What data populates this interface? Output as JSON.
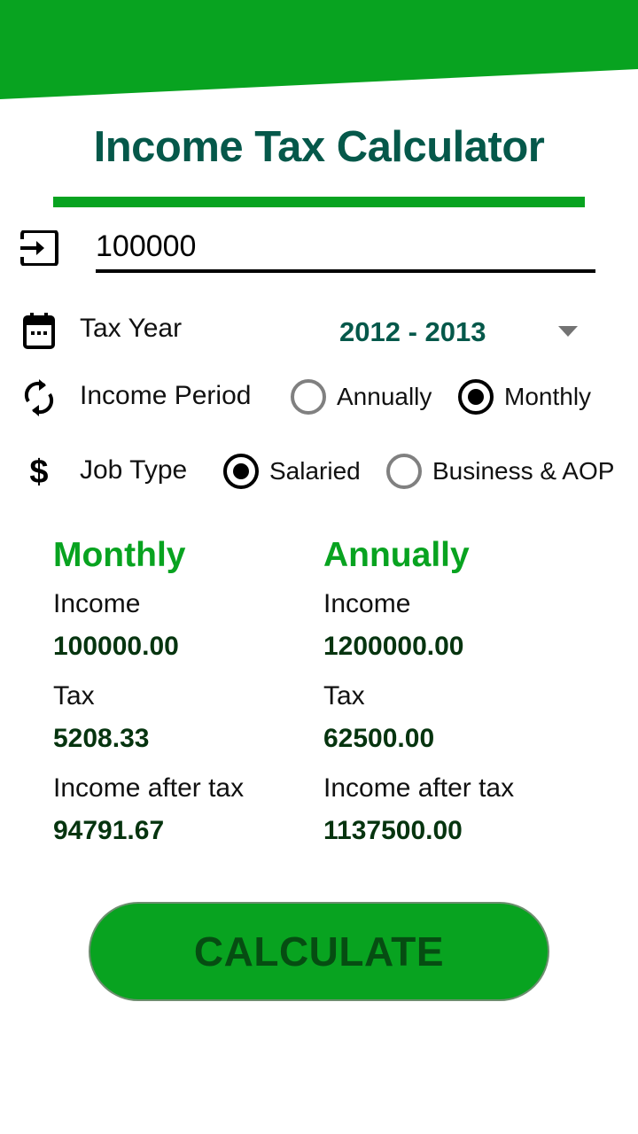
{
  "app": {
    "title": "Income Tax Calculator",
    "accent_color": "#08a320",
    "title_color": "#05584a"
  },
  "income_input": {
    "icon": "input-icon",
    "value": "100000"
  },
  "tax_year": {
    "icon": "calendar-icon",
    "label": "Tax Year",
    "selected": "2012 - 2013"
  },
  "income_period": {
    "icon": "sync-icon",
    "label": "Income Period",
    "options": [
      {
        "label": "Annually",
        "checked": false
      },
      {
        "label": "Monthly",
        "checked": true
      }
    ]
  },
  "job_type": {
    "icon": "dollar-icon",
    "label": "Job Type",
    "options": [
      {
        "label": "Salaried",
        "checked": true
      },
      {
        "label": "Business & AOP",
        "checked": false
      }
    ]
  },
  "results": {
    "monthly": {
      "heading": "Monthly",
      "income_label": "Income",
      "income": "100000.00",
      "tax_label": "Tax",
      "tax": "5208.33",
      "after_tax_label": "Income after tax",
      "after_tax": "94791.67"
    },
    "annually": {
      "heading": "Annually",
      "income_label": "Income",
      "income": "1200000.00",
      "tax_label": "Tax",
      "tax": "62500.00",
      "after_tax_label": "Income after tax",
      "after_tax": "1137500.00"
    }
  },
  "calculate_button": {
    "label": "CALCULATE"
  }
}
